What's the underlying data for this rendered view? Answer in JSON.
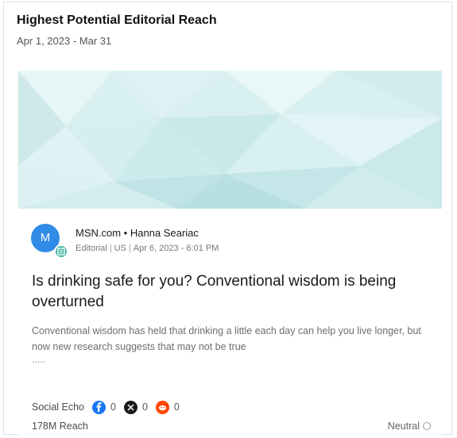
{
  "widget": {
    "title": "Highest Potential Editorial Reach",
    "date_range": "Apr 1, 2023 - Mar 31"
  },
  "article": {
    "avatar_letter": "M",
    "source_line": "MSN.com • Hanna Seariac",
    "type": "Editorial",
    "country": "US",
    "published": "Apr 6, 2023 - 6:01 PM",
    "headline": "Is drinking safe for you? Conventional wisdom is being overturned",
    "summary": "Conventional wisdom has held that drinking a little each day can help you live longer, but now new research suggests that may not be true",
    "summary_ellipsis": ".....",
    "social_echo": {
      "label": "Social Echo",
      "facebook": "0",
      "x": "0",
      "reddit": "0"
    },
    "reach": "178M Reach",
    "sentiment": "Neutral"
  },
  "colors": {
    "banner": "#d8eff0",
    "avatar": "#2f8be6",
    "facebook": "#1877f2",
    "x": "#1a1a1a",
    "reddit": "#ff4500"
  }
}
